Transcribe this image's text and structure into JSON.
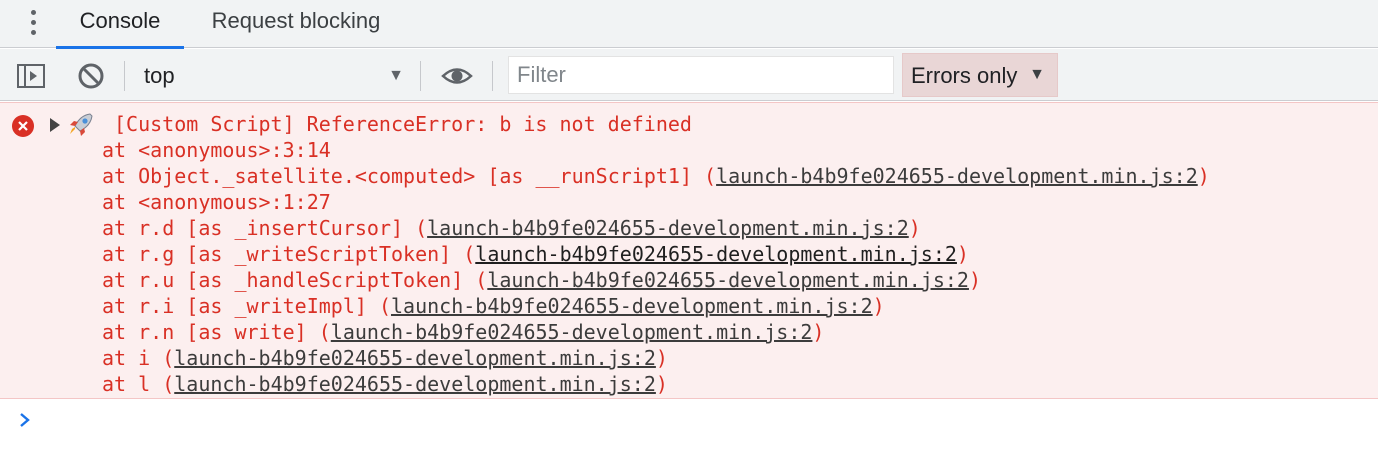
{
  "tabs": [
    {
      "label": "Console",
      "active": true
    },
    {
      "label": "Request blocking",
      "active": false
    }
  ],
  "toolbar": {
    "sidebar_icon": "sidebar-toggle-icon",
    "clear_icon": "clear-console-icon",
    "context": "top",
    "eye_icon": "eye-icon",
    "filter_placeholder": "Filter",
    "filter_value": "",
    "levels_label": "Errors only"
  },
  "colors": {
    "error_red": "#d93025",
    "error_bg": "#fcefef",
    "accent_blue": "#1a73e8",
    "toolbar_bg": "#f1f3f4"
  },
  "message": {
    "icons": [
      "error-icon",
      "expand-triangle-icon",
      "rocket-icon"
    ],
    "text": "[Custom Script] ReferenceError: b is not defined",
    "stack": [
      {
        "prefix": "at <anonymous>:3:14",
        "link": "",
        "suffix": ""
      },
      {
        "prefix": "at Object._satellite.<computed> [as __runScript1] (",
        "link": "launch-b4b9fe024655-development.min.js:2",
        "suffix": ")"
      },
      {
        "prefix": "at <anonymous>:1:27",
        "link": "",
        "suffix": ""
      },
      {
        "prefix": "at r.d [as _insertCursor] (",
        "link": "launch-b4b9fe024655-development.min.js:2",
        "suffix": ")"
      },
      {
        "prefix": "at r.g [as _writeScriptToken] (",
        "link": "launch-b4b9fe024655-development.min.js:2",
        "suffix": ")"
      },
      {
        "prefix": "at r.u [as _handleScriptToken] (",
        "link": "launch-b4b9fe024655-development.min.js:2",
        "suffix": ")"
      },
      {
        "prefix": "at r.i [as _writeImpl] (",
        "link": "launch-b4b9fe024655-development.min.js:2",
        "suffix": ")"
      },
      {
        "prefix": "at r.n [as write] (",
        "link": "launch-b4b9fe024655-development.min.js:2",
        "suffix": ")"
      },
      {
        "prefix": "at i (",
        "link": "launch-b4b9fe024655-development.min.js:2",
        "suffix": ")"
      },
      {
        "prefix": "at l (",
        "link": "launch-b4b9fe024655-development.min.js:2",
        "suffix": ")"
      }
    ]
  },
  "prompt": {
    "icon": "prompt-chevron-icon",
    "value": ""
  }
}
